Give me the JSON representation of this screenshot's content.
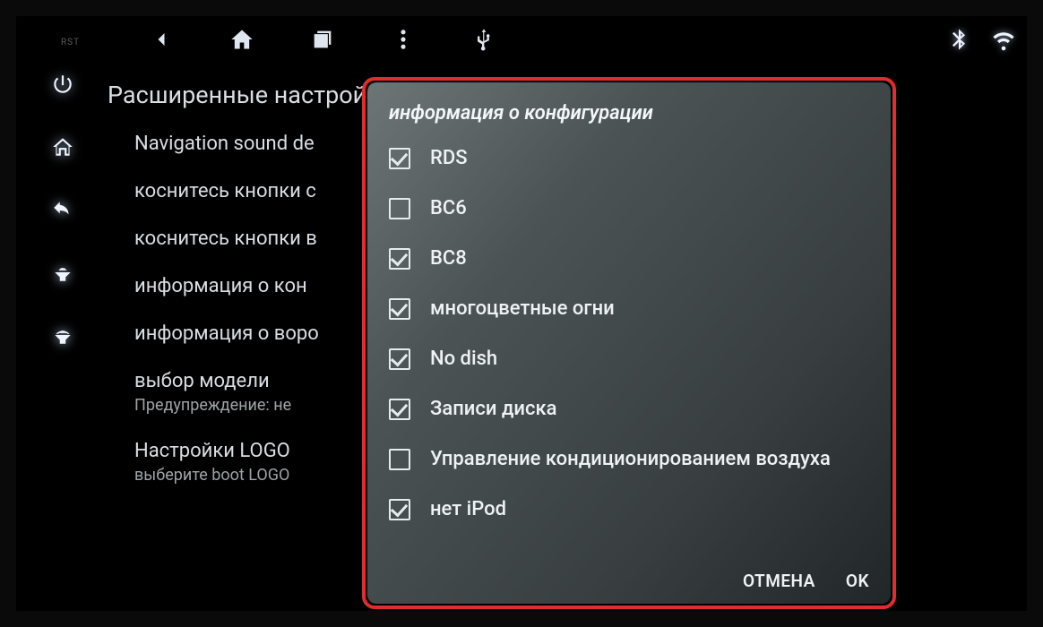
{
  "branding": "RST",
  "settings": {
    "title": "Расширенные настройки",
    "items": [
      {
        "label": "Navigation sound de"
      },
      {
        "label": "коснитесь кнопки с"
      },
      {
        "label": "коснитесь кнопки в"
      },
      {
        "label": "информация о кон"
      },
      {
        "label": "информация о воро"
      },
      {
        "label": "выбор модели",
        "sub": "Предупреждение: не "
      },
      {
        "label": "Настройки LOGO",
        "sub": "выберите boot LOGO"
      }
    ]
  },
  "dialog": {
    "title": "информация о конфигурации",
    "options": [
      {
        "label": "RDS",
        "checked": true
      },
      {
        "label": "BC6",
        "checked": false
      },
      {
        "label": "BC8",
        "checked": true
      },
      {
        "label": "многоцветные огни",
        "checked": true
      },
      {
        "label": "No dish",
        "checked": true
      },
      {
        "label": "Записи диска",
        "checked": true
      },
      {
        "label": "Управление кондиционированием воздуха",
        "checked": false
      },
      {
        "label": "нет iPod",
        "checked": true
      }
    ],
    "cancel": "ОТМЕНА",
    "ok": "OK"
  }
}
